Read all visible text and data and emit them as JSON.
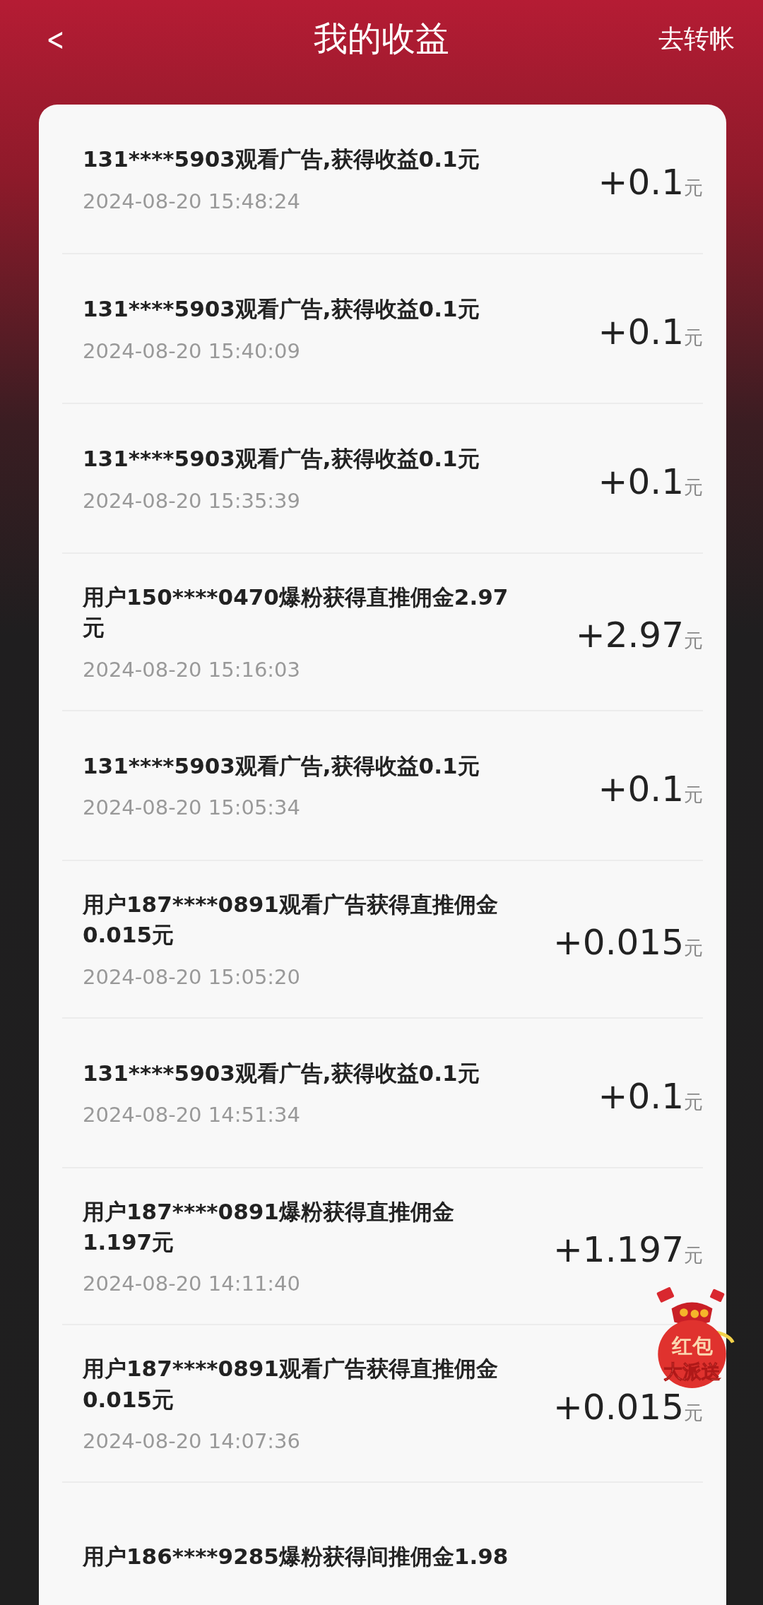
{
  "header": {
    "back": "<",
    "title": "我的收益",
    "action": "去转帐"
  },
  "records": [
    {
      "title": "131****5903观看广告,获得收益0.1元",
      "time": "2024-08-20 15:48:24",
      "amount": "+0.1",
      "unit": "元"
    },
    {
      "title": "131****5903观看广告,获得收益0.1元",
      "time": "2024-08-20 15:40:09",
      "amount": "+0.1",
      "unit": "元"
    },
    {
      "title": "131****5903观看广告,获得收益0.1元",
      "time": "2024-08-20 15:35:39",
      "amount": "+0.1",
      "unit": "元"
    },
    {
      "title": "用户150****0470爆粉获得直推佣金2.97元",
      "time": "2024-08-20 15:16:03",
      "amount": "+2.97",
      "unit": "元"
    },
    {
      "title": "131****5903观看广告,获得收益0.1元",
      "time": "2024-08-20 15:05:34",
      "amount": "+0.1",
      "unit": "元"
    },
    {
      "title": "用户187****0891观看广告获得直推佣金0.015元",
      "time": "2024-08-20 15:05:20",
      "amount": "+0.015",
      "unit": "元"
    },
    {
      "title": "131****5903观看广告,获得收益0.1元",
      "time": "2024-08-20 14:51:34",
      "amount": "+0.1",
      "unit": "元"
    },
    {
      "title": "用户187****0891爆粉获得直推佣金1.197元",
      "time": "2024-08-20 14:11:40",
      "amount": "+1.197",
      "unit": "元"
    },
    {
      "title": "用户187****0891观看广告获得直推佣金0.015元",
      "time": "2024-08-20 14:07:36",
      "amount": "+0.015",
      "unit": "元"
    },
    {
      "title": "用户186****9285爆粉获得间推佣金1.98"
    }
  ],
  "promo": {
    "line1": "红包",
    "line2": "大派送"
  }
}
